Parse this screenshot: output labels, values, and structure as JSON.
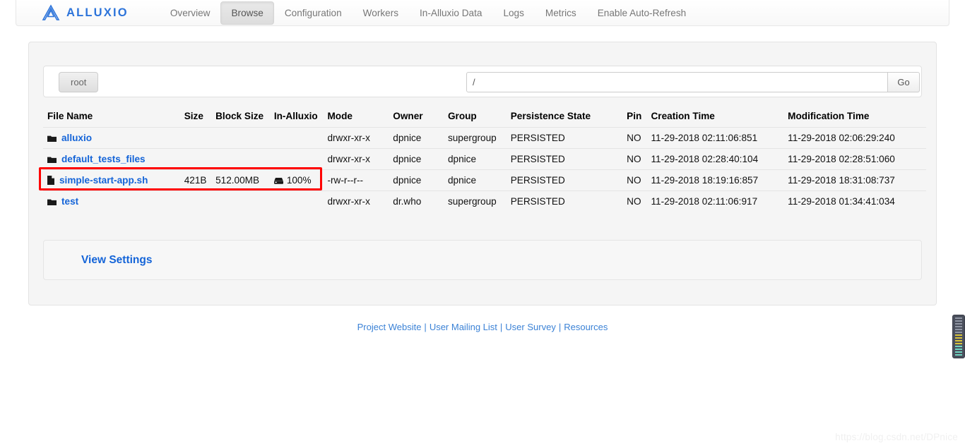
{
  "brand": {
    "name": "ALLUXIO",
    "logo_icon": "alluxio-mountain-icon",
    "color": "#2d74da"
  },
  "nav": {
    "items": [
      {
        "label": "Overview",
        "active": false
      },
      {
        "label": "Browse",
        "active": true
      },
      {
        "label": "Configuration",
        "active": false
      },
      {
        "label": "Workers",
        "active": false
      },
      {
        "label": "In-Alluxio Data",
        "active": false
      },
      {
        "label": "Logs",
        "active": false
      },
      {
        "label": "Metrics",
        "active": false
      },
      {
        "label": "Enable Auto-Refresh",
        "active": false
      }
    ]
  },
  "pathbar": {
    "breadcrumb_label": "root",
    "input_value": "/",
    "input_placeholder": "/",
    "go_label": "Go"
  },
  "table": {
    "headers": [
      "File Name",
      "Size",
      "Block Size",
      "In-Alluxio",
      "Mode",
      "Owner",
      "Group",
      "Persistence State",
      "Pin",
      "Creation Time",
      "Modification Time"
    ],
    "rows": [
      {
        "icon": "folder-icon",
        "name": "alluxio",
        "size": "",
        "block_size": "",
        "in_alluxio": "",
        "in_alluxio_icon": "",
        "mode": "drwxr-xr-x",
        "owner": "dpnice",
        "group": "supergroup",
        "persistence_state": "PERSISTED",
        "pin": "NO",
        "creation_time": "11-29-2018 02:11:06:851",
        "modification_time": "11-29-2018 02:06:29:240",
        "highlighted": false
      },
      {
        "icon": "folder-icon",
        "name": "default_tests_files",
        "size": "",
        "block_size": "",
        "in_alluxio": "",
        "in_alluxio_icon": "",
        "mode": "drwxr-xr-x",
        "owner": "dpnice",
        "group": "dpnice",
        "persistence_state": "PERSISTED",
        "pin": "NO",
        "creation_time": "11-29-2018 02:28:40:104",
        "modification_time": "11-29-2018 02:28:51:060",
        "highlighted": false
      },
      {
        "icon": "file-icon",
        "name": "simple-start-app.sh",
        "size": "421B",
        "block_size": "512.00MB",
        "in_alluxio": "100%",
        "in_alluxio_icon": "hard-drive-icon",
        "mode": "-rw-r--r--",
        "owner": "dpnice",
        "group": "dpnice",
        "persistence_state": "PERSISTED",
        "pin": "NO",
        "creation_time": "11-29-2018 18:19:16:857",
        "modification_time": "11-29-2018 18:31:08:737",
        "highlighted": true
      },
      {
        "icon": "folder-icon",
        "name": "test",
        "size": "",
        "block_size": "",
        "in_alluxio": "",
        "in_alluxio_icon": "",
        "mode": "drwxr-xr-x",
        "owner": "dr.who",
        "group": "supergroup",
        "persistence_state": "PERSISTED",
        "pin": "NO",
        "creation_time": "11-29-2018 02:11:06:917",
        "modification_time": "11-29-2018 01:34:41:034",
        "highlighted": false
      }
    ]
  },
  "view_settings": {
    "label": "View Settings"
  },
  "footer": {
    "links": [
      {
        "label": "Project Website"
      },
      {
        "label": "User Mailing List"
      },
      {
        "label": "User Survey"
      },
      {
        "label": "Resources"
      }
    ],
    "separator": "|"
  },
  "watermark": {
    "text": "https://blog.csdn.net/DPnice"
  },
  "highlight": {
    "color": "#ff0000",
    "target": "simple-start-app.sh"
  }
}
